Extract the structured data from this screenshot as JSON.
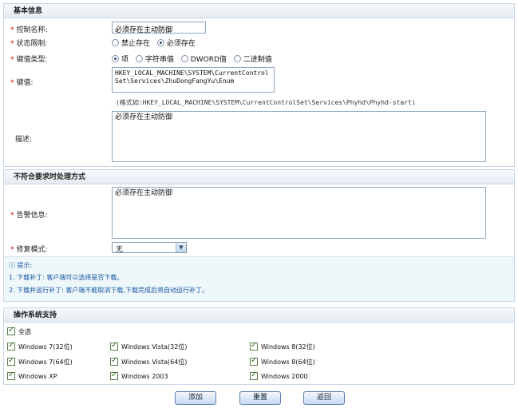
{
  "basic": {
    "header": "基本信息",
    "control_name_label": "控制名称:",
    "control_name_value": "必须存在主动防御",
    "state_label": "状态限制:",
    "state_options": [
      "禁止存在",
      "必须存在"
    ],
    "key_type_label": "键值类型:",
    "key_type_options": [
      "项",
      "字符串值",
      "DWORD值",
      "二进制值"
    ],
    "key_label": "键值:",
    "key_value": "HKEY_LOCAL_MACHINE\\SYSTEM\\CurrentControlSet\\Services\\ZhuDongFangYu\\Enum",
    "key_hint": "(格式如:HKEY_LOCAL_MACHINE\\SYSTEM\\CurrentControlSet\\Services\\Phyhd\\Phyhd-start)",
    "desc_label": "描述:",
    "desc_value": "必须存在主动防御"
  },
  "violation": {
    "header": "不符合要求时处理方式",
    "alert_label": "告警信息:",
    "alert_value": "必须存在主动防御",
    "repair_label": "修复模式:",
    "repair_value": "无",
    "tips_title": "提示:",
    "tip1": "1. 下载补丁: 客户端可以选择是否下载。",
    "tip2": "2. 下载并运行补丁: 客户端不能取消下载,下载完成后将自动运行补丁。"
  },
  "os": {
    "header": "操作系统支持",
    "select_all": "全选",
    "items": [
      "Windows 7(32位)",
      "Windows Vista(32位)",
      "Windows 8(32位)",
      "Windows 7(64位)",
      "Windows Vista(64位)",
      "Windows 8(64位)",
      "Windows XP",
      "Windows 2003",
      "Windows 2000"
    ]
  },
  "buttons": {
    "add": "添加",
    "reset": "重置",
    "back": "返回"
  }
}
